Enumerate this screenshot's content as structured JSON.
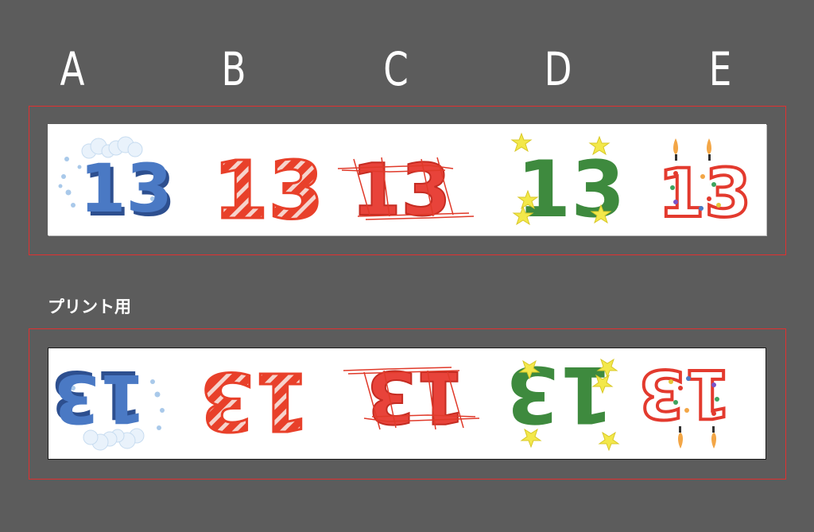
{
  "columns": [
    {
      "letter": "A",
      "style": "snow",
      "number": "13"
    },
    {
      "letter": "B",
      "style": "candy-cane",
      "number": "13"
    },
    {
      "letter": "C",
      "style": "scribble",
      "number": "13"
    },
    {
      "letter": "D",
      "style": "stars",
      "number": "13"
    },
    {
      "letter": "E",
      "style": "candle",
      "number": "13"
    }
  ],
  "print_section": {
    "label": "プリント用"
  },
  "colors": {
    "background": "#5c5c5c",
    "frame": "#e03030",
    "snow_blue": "#4a79c4",
    "candy_red": "#e8402a",
    "scribble_red": "#e03a2a",
    "star_green": "#3e8a3e",
    "star_yellow": "#f3e84a",
    "candle_red": "#e33a2e"
  }
}
